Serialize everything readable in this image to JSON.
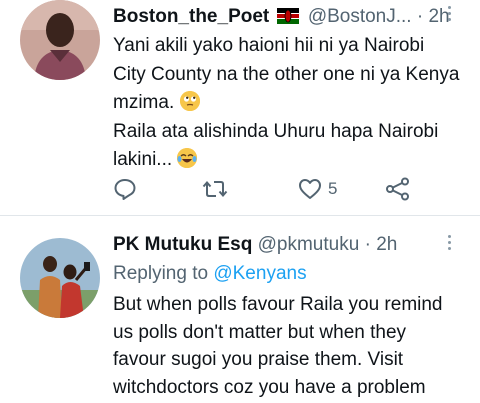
{
  "tweets": [
    {
      "name": "Boston_the_Poet",
      "flag_icon": "kenya-flag-icon",
      "handle": "@BostonJ...",
      "separator": "·",
      "time": "2h",
      "lines": [
        "Yani akili yako haioni hii ni ya Nairobi",
        "City County na the other one ni ya Kenya",
        "mzima.",
        "Raila ata alishinda Uhuru hapa Nairobi",
        "lakini..."
      ],
      "emojis": [
        "face-with-rolling-eyes",
        "face-with-tears-of-joy"
      ],
      "like_count": "5",
      "action_icons": [
        "reply-icon",
        "retweet-icon",
        "like-icon",
        "share-icon"
      ]
    },
    {
      "name": "PK Mutuku Esq",
      "handle": "@pkmutuku",
      "separator": "·",
      "time": "2h",
      "replying_to_label": "Replying to",
      "replying_to_handle": "@Kenyans",
      "lines": [
        "But when polls favour Raila you remind",
        "us polls don't matter but when they",
        "favour sugoi you praise them. Visit",
        "witchdoctors coz you have a problem"
      ]
    }
  ],
  "colors": {
    "text": "#0f1419",
    "secondary": "#536471",
    "link": "#1da1f2",
    "divider": "#e1e6ea"
  }
}
